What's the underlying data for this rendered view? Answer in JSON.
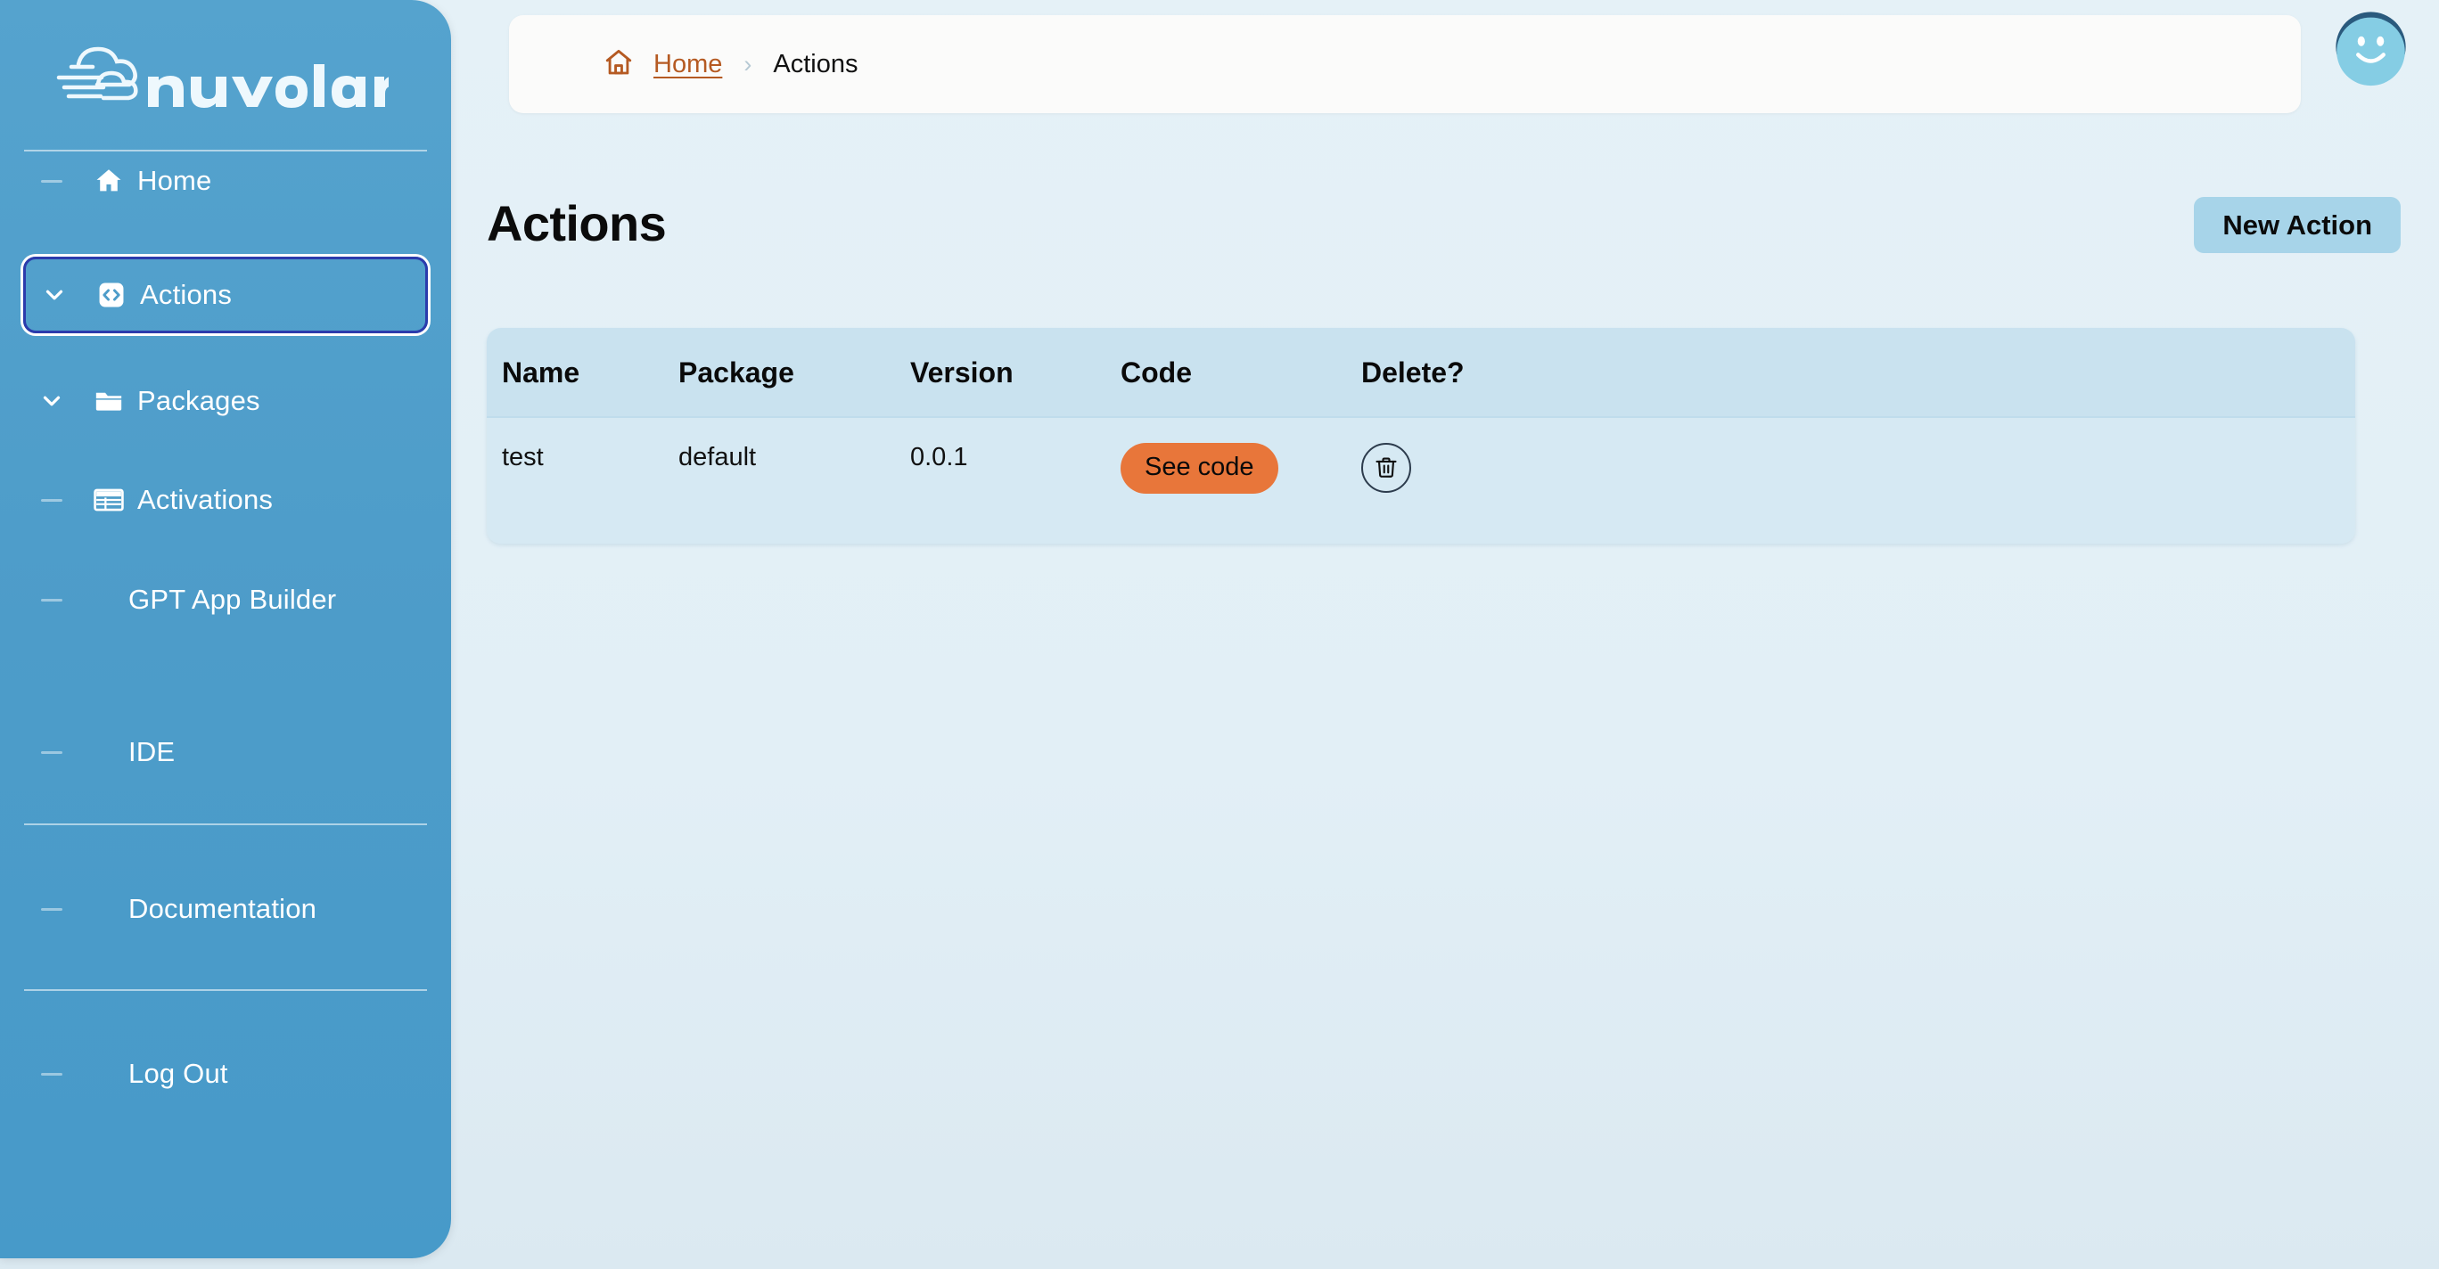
{
  "brand": {
    "name": "nuvolaris",
    "logo_icon": "cloud-speed-icon"
  },
  "sidebar": {
    "items": [
      {
        "id": "home",
        "label": "Home",
        "icon": "home-icon",
        "marker": "dash"
      },
      {
        "id": "actions",
        "label": "Actions",
        "icon": "code-brackets-icon",
        "marker": "chevron-down",
        "selected": true
      },
      {
        "id": "packages",
        "label": "Packages",
        "icon": "folder-icon",
        "marker": "chevron-down"
      },
      {
        "id": "activations",
        "label": "Activations",
        "icon": "table-icon",
        "marker": "dash"
      },
      {
        "id": "gpt",
        "label": "GPT App Builder",
        "icon": "",
        "marker": "dash"
      },
      {
        "id": "ide",
        "label": "IDE",
        "icon": "",
        "marker": "dash"
      },
      {
        "id": "docs",
        "label": "Documentation",
        "icon": "",
        "marker": "dash"
      },
      {
        "id": "logout",
        "label": "Log Out",
        "icon": "",
        "marker": "dash"
      }
    ]
  },
  "header": {
    "breadcrumb": {
      "home_icon": "home-outline-icon",
      "home_label": "Home",
      "separator": "›",
      "current": "Actions"
    },
    "avatar_icon": "smiley-avatar-icon"
  },
  "main": {
    "title": "Actions",
    "new_action_label": "New Action",
    "table": {
      "columns": [
        "Name",
        "Package",
        "Version",
        "Code",
        "Delete?"
      ],
      "rows": [
        {
          "name": "test",
          "package": "default",
          "version": "0.0.1",
          "code_label": "See code",
          "delete_icon": "trash-icon"
        }
      ]
    }
  },
  "colors": {
    "sidebar_blue": "#4d9cc9",
    "page_bg": "#e3f0f7",
    "accent_orange": "#e8763a",
    "breadcrumb_link": "#b55a22",
    "button_blue": "#a7d4e9",
    "table_header": "#c9e2ef",
    "table_row": "#d6e9f3",
    "focus_ring": "#2b3bac"
  }
}
